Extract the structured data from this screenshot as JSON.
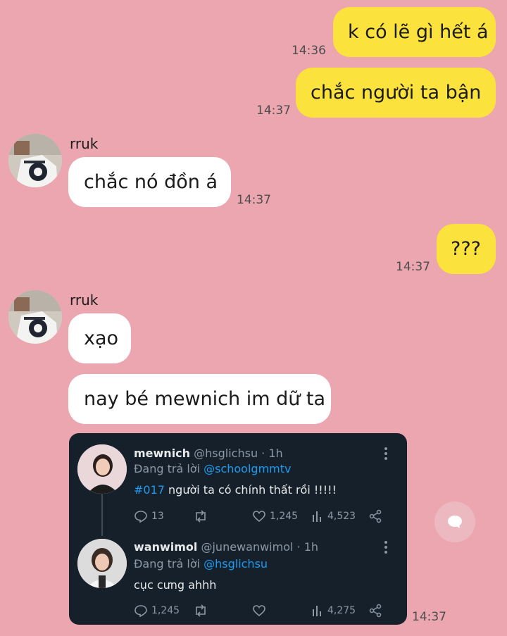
{
  "messages": {
    "m1": {
      "text": "k có lẽ gì hết á",
      "time": "14:36"
    },
    "m2": {
      "text": "chắc người ta bận",
      "time": "14:37"
    },
    "m3": {
      "sender": "rruk",
      "text": "chắc nó đồn á",
      "time": "14:37"
    },
    "m4": {
      "text": "???",
      "time": "14:37"
    },
    "m5": {
      "sender": "rruk",
      "text": "xạo"
    },
    "m6": {
      "text": "nay bé mewnich im dữ ta"
    },
    "m7_time": "14:37"
  },
  "tweet1": {
    "name": "mewnich",
    "handle_time": "@hsglichsu · 1h",
    "reply_prefix": "Đang trả lời",
    "reply_to": "@schoolgmmtv",
    "hashtag": "#017",
    "text": " người ta có chính thất rồi !!!!!",
    "replies": "13",
    "likes": "1,245",
    "views": "4,523"
  },
  "tweet2": {
    "name": "wanwimol",
    "handle_time": "@junewanwimol · 1h",
    "reply_prefix": "Đang trả lời",
    "reply_to": "@hsglichsu",
    "text": "cục cưng ahhh",
    "replies": "1,245",
    "views": "4,275"
  },
  "colors": {
    "background": "#EBA6B0",
    "outgoing_bubble": "#FBE23C",
    "incoming_bubble": "#FFFFFF",
    "card_bg": "#15202B",
    "link": "#1D9BF0"
  },
  "icons": [
    "reply-icon",
    "retweet-icon",
    "heart-icon",
    "views-icon",
    "share-icon",
    "more-icon",
    "chat-bubble-icon"
  ]
}
